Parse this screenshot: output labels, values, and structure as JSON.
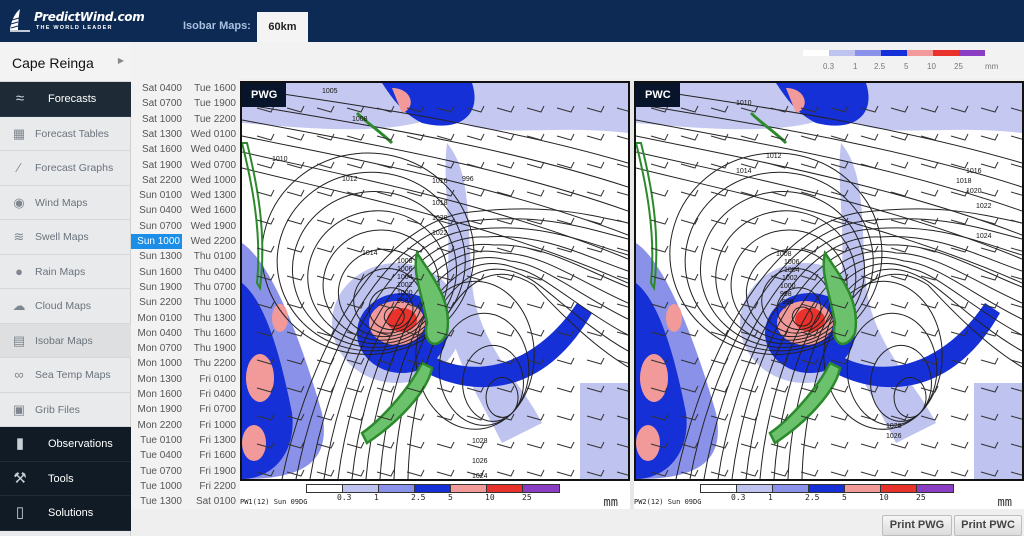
{
  "header": {
    "brand": "PredictWind.com",
    "tagline": "THE WORLD LEADER",
    "map_type_label": "Isobar Maps:",
    "resolution_tab": "60km"
  },
  "sidebar": {
    "location": "Cape Reinga",
    "items": [
      {
        "label": "Forecasts",
        "icon": "wind-icon",
        "style": "section"
      },
      {
        "label": "Forecast Tables",
        "icon": "table-icon"
      },
      {
        "label": "Forecast Graphs",
        "icon": "graph-icon"
      },
      {
        "label": "Wind Maps",
        "icon": "globe-icon"
      },
      {
        "label": "Swell Maps",
        "icon": "wave-icon"
      },
      {
        "label": "Rain Maps",
        "icon": "raindrop-icon"
      },
      {
        "label": "Cloud Maps",
        "icon": "cloud-icon"
      },
      {
        "label": "Isobar Maps",
        "icon": "isobar-icon",
        "active": true
      },
      {
        "label": "Sea Temp Maps",
        "icon": "thermometer-icon"
      },
      {
        "label": "Grib Files",
        "icon": "file-icon"
      },
      {
        "label": "Observations",
        "icon": "observations-icon",
        "style": "section"
      },
      {
        "label": "Tools",
        "icon": "hammer-icon",
        "style": "section"
      },
      {
        "label": "Solutions",
        "icon": "phone-icon",
        "style": "section"
      }
    ]
  },
  "legend": {
    "labels": [
      "0.3",
      "1",
      "2.5",
      "5",
      "10",
      "25"
    ],
    "unit": "mm",
    "colors": [
      "#ffffff",
      "#bfc3f0",
      "#8a91e8",
      "#1630d8",
      "#f29a9a",
      "#e8322b",
      "#8a3cc2"
    ]
  },
  "times": {
    "selected": "Sun 1000",
    "col1": [
      "Sat 0400",
      "Sat 0700",
      "Sat 1000",
      "Sat 1300",
      "Sat 1600",
      "Sat 1900",
      "Sat 2200",
      "Sun 0100",
      "Sun 0400",
      "Sun 0700",
      "Sun 1000",
      "Sun 1300",
      "Sun 1600",
      "Sun 1900",
      "Sun 2200",
      "Mon 0100",
      "Mon 0400",
      "Mon 0700",
      "Mon 1000",
      "Mon 1300",
      "Mon 1600",
      "Mon 1900",
      "Mon 2200",
      "Tue 0100",
      "Tue 0400",
      "Tue 0700",
      "Tue 1000",
      "Tue 1300"
    ],
    "col2": [
      "Tue 1600",
      "Tue 1900",
      "Tue 2200",
      "Wed 0100",
      "Wed 0400",
      "Wed 0700",
      "Wed 1000",
      "Wed 1300",
      "Wed 1600",
      "Wed 1900",
      "Wed 2200",
      "Thu 0100",
      "Thu 0400",
      "Thu 0700",
      "Thu 1000",
      "Thu 1300",
      "Thu 1600",
      "Thu 1900",
      "Thu 2200",
      "Fri 0100",
      "Fri 0400",
      "Fri 0700",
      "Fri 1000",
      "Fri 1300",
      "Fri 1600",
      "Fri 1900",
      "Fri 2200",
      "Sat 0100"
    ]
  },
  "panels": [
    {
      "id": "pwg",
      "badge": "PWG",
      "run_label": "PW1(12) Sun 09DG",
      "isobar_labels": [
        "1005",
        "1008",
        "1010",
        "1012",
        "1014",
        "1008",
        "1006",
        "1004",
        "1002",
        "1000",
        "998",
        "996",
        "1016",
        "1018",
        "1020",
        "1022",
        "1024",
        "1026",
        "1028"
      ],
      "print_label": "Print PWG"
    },
    {
      "id": "pwc",
      "badge": "PWC",
      "run_label": "PW2(12) Sun 09DG",
      "isobar_labels": [
        "1010",
        "1012",
        "1014",
        "1008",
        "1006",
        "1004",
        "1002",
        "1000",
        "998",
        "996",
        "1016",
        "1018",
        "1020",
        "1022",
        "1024",
        "1026",
        "1028"
      ],
      "print_label": "Print PWC"
    }
  ]
}
